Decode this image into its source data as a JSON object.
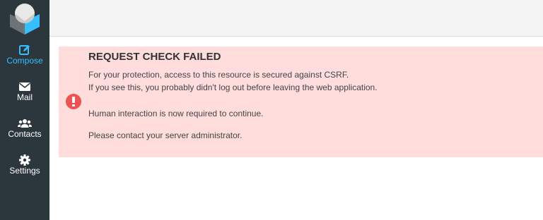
{
  "sidebar": {
    "logo_icon": "roundcube-logo-icon",
    "items": [
      {
        "label": "Compose",
        "icon": "compose-icon",
        "active": true
      },
      {
        "label": "Mail",
        "icon": "envelope-icon",
        "active": false
      },
      {
        "label": "Contacts",
        "icon": "users-icon",
        "active": false
      },
      {
        "label": "Settings",
        "icon": "gear-icon",
        "active": false
      }
    ]
  },
  "alert": {
    "icon": "exclamation-circle-icon",
    "title": "REQUEST CHECK FAILED",
    "line1": "For your protection, access to this resource is secured against CSRF.",
    "line2": "If you see this, you probably didn't log out before leaving the web application.",
    "line3": "Human interaction is now required to continue.",
    "line4": "Please contact your server administrator."
  },
  "colors": {
    "sidebar_bg": "#2c363d",
    "accent": "#37beff",
    "alert_bg": "#ffdddd",
    "alert_icon": "#ec5353"
  }
}
